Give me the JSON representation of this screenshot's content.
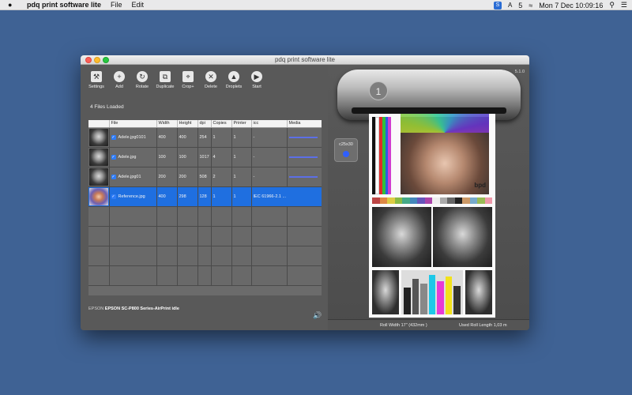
{
  "menubar": {
    "app_name": "pdq print software lite",
    "menus": [
      "File",
      "Edit"
    ],
    "status_count": "5",
    "clock": "Mon 7 Dec  10:09:16"
  },
  "window": {
    "title": "pdq print software lite"
  },
  "toolbar": {
    "settings": "Settings",
    "add": "Add",
    "rotate": "Rotate",
    "duplicate": "Duplicate",
    "crop": "Crop+",
    "delete": "Delete",
    "droplets": "Droplets",
    "start": "Start"
  },
  "files_loaded": "4 Files Loaded",
  "table": {
    "headers": [
      "File",
      "Width",
      "Height",
      "dpi",
      "Copies",
      "Printer",
      "icc",
      "Media"
    ],
    "rows": [
      {
        "file": "Adele.jpg0101",
        "width": "400",
        "height": "400",
        "dpi": "254",
        "copies": "1",
        "printer": "1",
        "icc": "-"
      },
      {
        "file": "Adele.jpg",
        "width": "100",
        "height": "100",
        "dpi": "1017",
        "copies": "4",
        "printer": "1",
        "icc": "-"
      },
      {
        "file": "Adele.jpg01",
        "width": "200",
        "height": "200",
        "dpi": "508",
        "copies": "2",
        "printer": "1",
        "icc": "-"
      },
      {
        "file": "Reference.jpg",
        "width": "400",
        "height": "298",
        "dpi": "128",
        "copies": "1",
        "printer": "1",
        "icc": "IEC 61966-2.1 ..."
      }
    ]
  },
  "status": {
    "brand": "EPSON",
    "printer": "EPSON SC-P800 Series-AirPrint idle"
  },
  "preview": {
    "version": "5.1.0",
    "printer_number": "1",
    "size": "c25x30",
    "watermark": "bpd",
    "roll_width": "Roll Width  17\" (432mm )",
    "used_roll": "Used Roll Length  1,03 m"
  },
  "colors": {
    "desktop": "#3f6294",
    "selection": "#1f6fe0",
    "media_bar": "#5c6fe6"
  }
}
